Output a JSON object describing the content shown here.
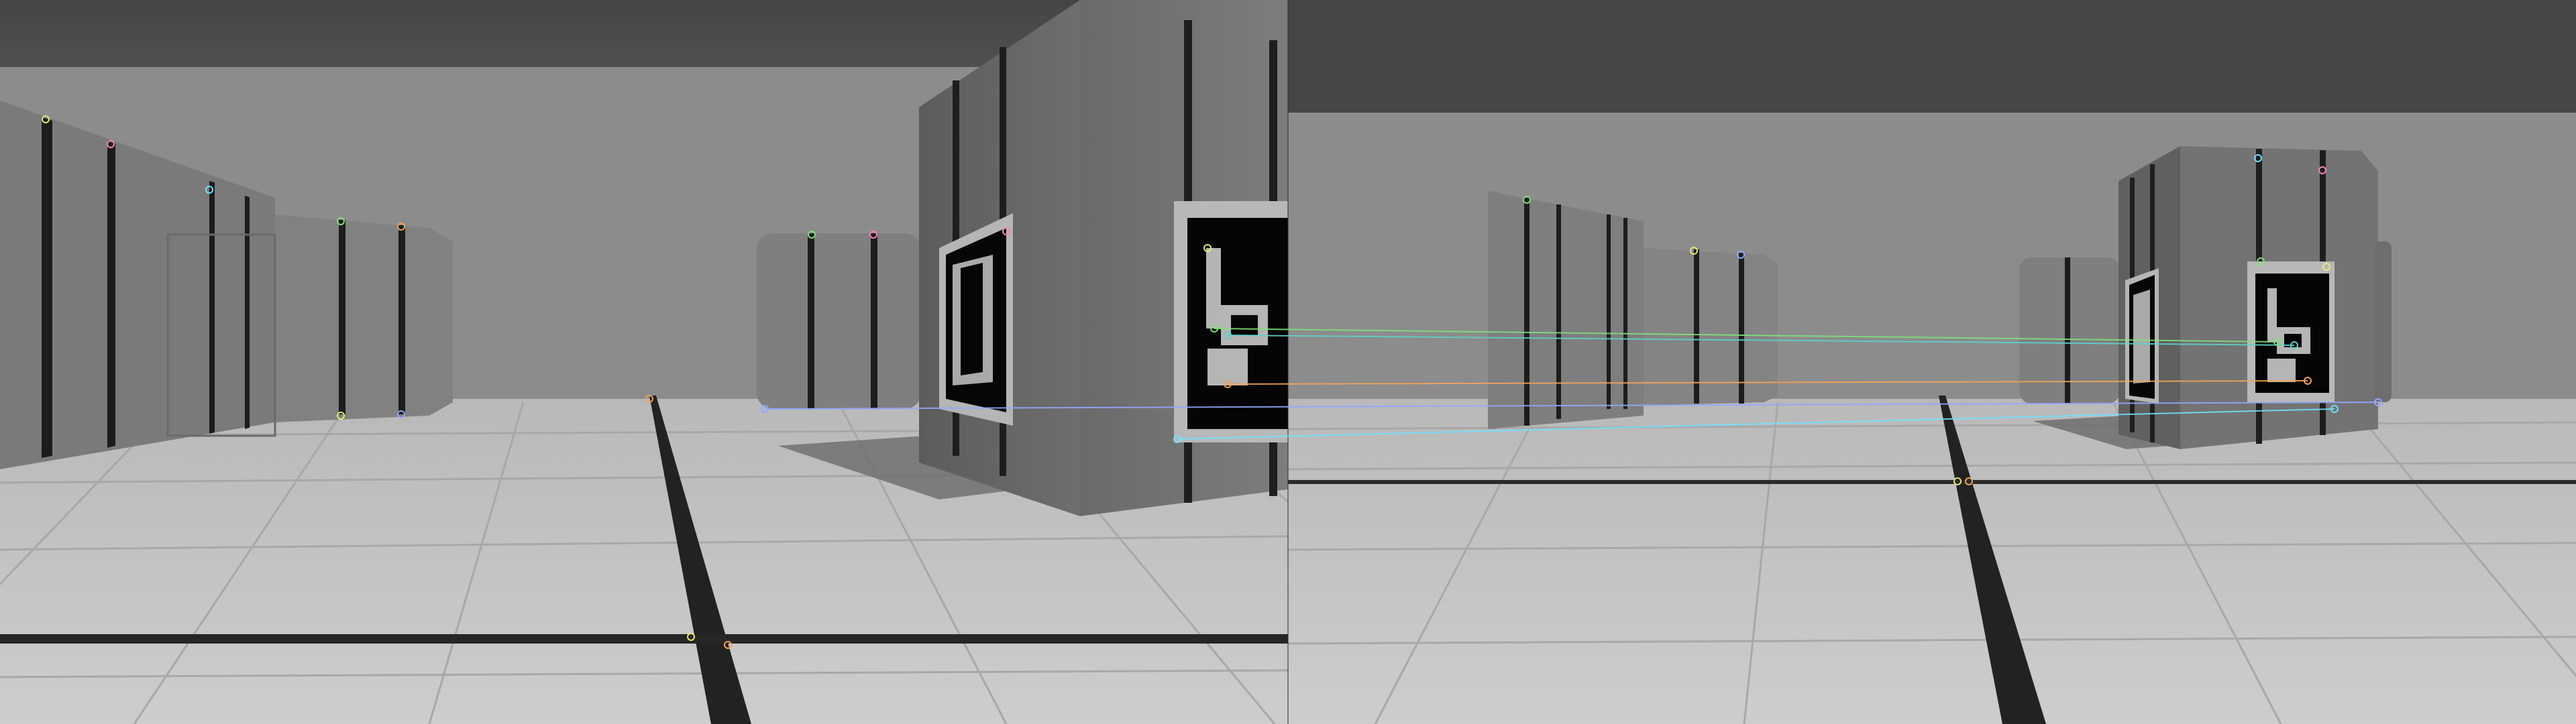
{
  "image": {
    "kind": "side-by-side feature match visualization",
    "panels": [
      "left-camera-view",
      "right-camera-view"
    ],
    "colors": {
      "sky": "#4a4a4a",
      "wall": "#8e8e8e",
      "floor": "#c4c4c4",
      "grid_line": "#a9a9a9",
      "box_face": "#707070",
      "box_dark": "#545454",
      "stripe": "#1e1e1e",
      "marker_black": "#050505",
      "marker_white": "#b8b8b8",
      "floor_line": "#262626"
    },
    "match_line_colors": [
      "#7fe07a",
      "#5fd0c8",
      "#f4a259",
      "#8fa8ff",
      "#e8e870",
      "#ff80c0",
      "#70e0ff"
    ]
  }
}
